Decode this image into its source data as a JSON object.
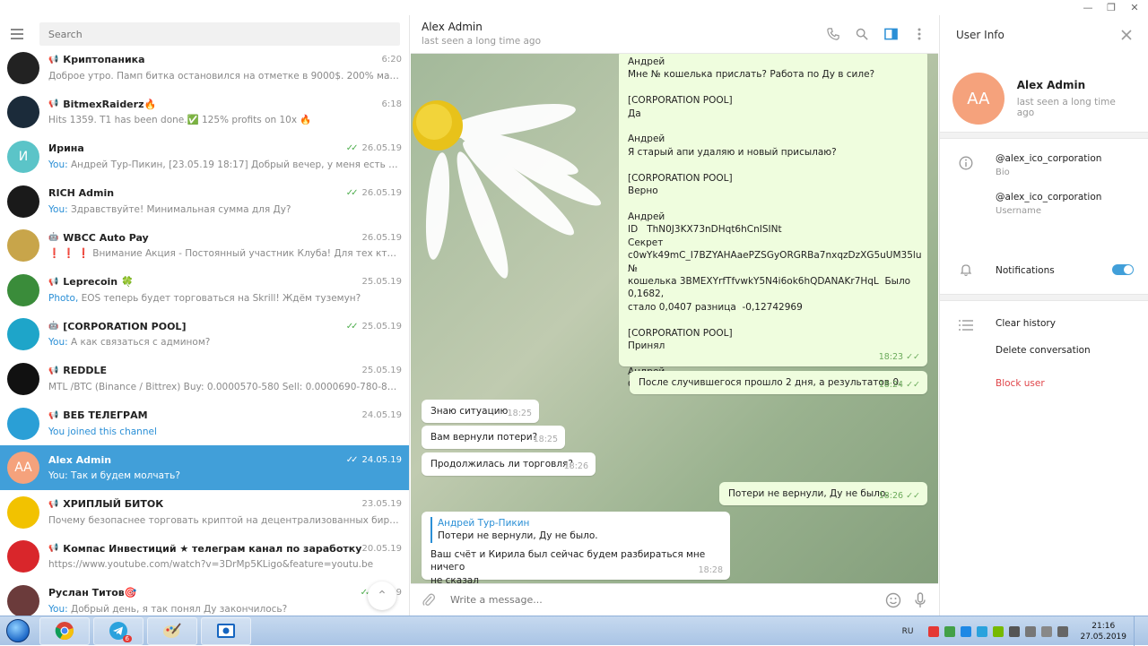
{
  "search": {
    "placeholder": "Search"
  },
  "chats": [
    {
      "name": "Криптопаника",
      "time": "6:20",
      "preview_prefix": "",
      "preview": "Доброе утро. Памп битка остановился на отметке в 9000$. 200% маржу проб...",
      "avatar_text": "",
      "avatar_color": "#222222",
      "kind": "channel",
      "checks": false
    },
    {
      "name": "BitmexRaiderz🔥",
      "time": "6:18",
      "preview_prefix": "",
      "preview": "Hits 1359. T1 has been done.✅ 125% profits on 10x 🔥",
      "avatar_text": "",
      "avatar_color": "#1b2b3a",
      "kind": "channel",
      "checks": false
    },
    {
      "name": "Ирина",
      "time": "26.05.19",
      "preview_prefix": "You:",
      "preview": "Андрей Тур-Пикин, [23.05.19 18:17] Добрый вечер, у меня есть вопросы п...",
      "avatar_text": "И",
      "avatar_color": "#5bc4c8",
      "kind": "user",
      "checks": true
    },
    {
      "name": "RICH Admin",
      "time": "26.05.19",
      "preview_prefix": "You:",
      "preview": "Здравствуйте! Минимальная сумма для Ду?",
      "avatar_text": "",
      "avatar_color": "#1a1a1a",
      "kind": "user",
      "checks": true
    },
    {
      "name": "WBCC Auto Pay",
      "time": "26.05.19",
      "preview_prefix": "",
      "preview": "❗ ❗ ❗  Внимание Акция - Постоянный участник Клуба!   Для тех кто хочет ...",
      "avatar_text": "",
      "avatar_color": "#c8a54a",
      "kind": "bot",
      "checks": false
    },
    {
      "name": "Leprecoin 🍀",
      "time": "25.05.19",
      "preview_prefix": "Photo,",
      "preview": "EOS теперь будет торговаться на Skrill! Ждём туземун?",
      "avatar_text": "",
      "avatar_color": "#3a8c3a",
      "kind": "channel",
      "checks": false
    },
    {
      "name": "[CORPORATION POOL]",
      "time": "25.05.19",
      "preview_prefix": "You:",
      "preview": "А как связаться с админом?",
      "avatar_text": "",
      "avatar_color": "#1ea5c9",
      "kind": "bot",
      "checks": true
    },
    {
      "name": "REDDLE",
      "time": "25.05.19",
      "preview_prefix": "",
      "preview": "MTL /BTC (Binance / Bittrex)  Buy: 0.0000570-580  Sell: 0.0000690-780-860-990+",
      "avatar_text": "",
      "avatar_color": "#111111",
      "kind": "channel",
      "checks": false
    },
    {
      "name": "ВЕБ ТЕЛЕГРАМ",
      "time": "24.05.19",
      "preview_prefix": "You joined this channel",
      "preview": "",
      "avatar_text": "",
      "avatar_color": "#2a9fd6",
      "kind": "channel",
      "checks": false
    },
    {
      "name": "Alex Admin",
      "time": "24.05.19",
      "preview_prefix": "You:",
      "preview": "Так и будем молчать?",
      "avatar_text": "AA",
      "avatar_color": "#f5a27c",
      "kind": "user",
      "checks": true,
      "active": true
    },
    {
      "name": "ХРИПЛЫЙ БИТОК",
      "time": "23.05.19",
      "preview_prefix": "",
      "preview": "Почему безопаснее торговать криптой на децентрализованных биржах? ...",
      "avatar_text": "",
      "avatar_color": "#f2c200",
      "kind": "channel",
      "checks": false
    },
    {
      "name": "Компас Инвестиций ★ телеграм канал по заработку",
      "time": "20.05.19",
      "preview_prefix": "",
      "preview": "https://www.youtube.com/watch?v=3DrMp5KLigo&feature=youtu.be",
      "avatar_text": "",
      "avatar_color": "#d9262b",
      "kind": "channel",
      "checks": false
    },
    {
      "name": "Руслан Титов🎯",
      "time": "1...19",
      "preview_prefix": "You:",
      "preview": "Добрый день, я так понял Ду закончилось?",
      "avatar_text": "",
      "avatar_color": "#6b3b3b",
      "kind": "user",
      "checks": true
    }
  ],
  "chat": {
    "title": "Alex Admin",
    "status": "last seen a long time ago",
    "messages": [
      {
        "dir": "out",
        "text": "Андрей\nМне № кошелька прислать? Работа по Ду в силе?\n\n[CORPORATION POOL]\nДа\n\nАндрей\nЯ старый апи удаляю и новый присылаю?\n\n[CORPORATION POOL]\nВерно\n\nАндрей\nID   ThN0J3KX73nDHqt6hCnISINt\nСекрет\nc0wYk49mC_I7BZYAHAaePZSGyORGRBa7nxqzDzXG5uUM35lu  №\nкошелька 3BMEXYrfTfvwkY5N4i6ok6hQDANAKr7HqL  Было 0,1682,\nстало 0,0407 разница  -0,12742969\n\n[CORPORATION POOL]\nПринял\n\nАндрей\nСпасибо!",
        "time": "18:23",
        "read": true
      },
      {
        "dir": "out",
        "text": "После случившегося прошло 2 дня, а результатов 0.",
        "time": "18:24",
        "read": true
      },
      {
        "dir": "in",
        "text": "Знаю ситуацию",
        "time": "18:25"
      },
      {
        "dir": "in",
        "text": "Вам вернули потери?",
        "time": "18:25"
      },
      {
        "dir": "in",
        "text": "Продолжилась ли торговля?",
        "time": "18:26"
      },
      {
        "dir": "out",
        "text": "Потери не вернули, Ду не было.",
        "time": "18:26",
        "read": true
      },
      {
        "dir": "in",
        "reply_author": "Андрей Тур-Пикин",
        "reply_text": "Потери не вернули, Ду не было.",
        "text": "Ваш счёт и Кирила был сейчас будем разбираться мне ничего\nне сказал",
        "time": "18:28"
      }
    ],
    "composer_placeholder": "Write a message..."
  },
  "user_info": {
    "title": "User Info",
    "avatar_text": "AA",
    "name": "Alex Admin",
    "last_seen": "last seen a long time ago",
    "bio": "@alex_ico_corporation",
    "bio_label": "Bio",
    "username": "@alex_ico_corporation",
    "username_label": "Username",
    "notifications_label": "Notifications",
    "notifications_on": true,
    "clear_history": "Clear history",
    "delete_conversation": "Delete conversation",
    "block_user": "Block user"
  },
  "taskbar": {
    "lang": "RU",
    "time": "21:16",
    "date": "27.05.2019",
    "telegram_badge": "6"
  }
}
